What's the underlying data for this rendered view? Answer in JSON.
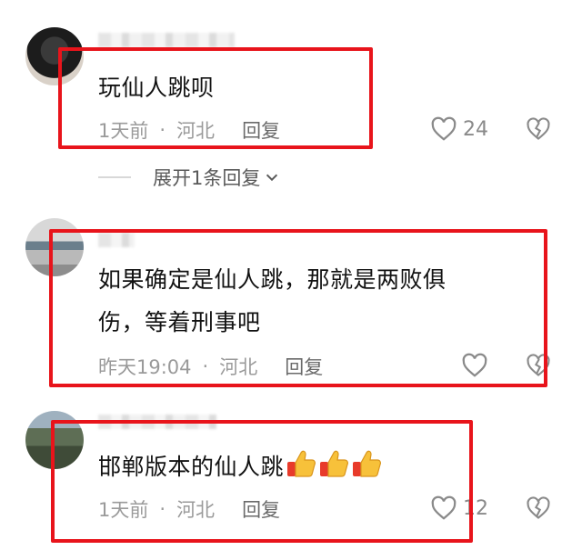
{
  "comments": [
    {
      "text": "玩仙人跳呗",
      "time": "1天前",
      "sep": "·",
      "location": "河北",
      "reply_label": "回复",
      "like_count": "24"
    },
    {
      "text_line1": "如果确定是仙人跳，那就是两败俱",
      "text_line2": "伤，等着刑事吧",
      "time": "昨天19:04",
      "sep": "·",
      "location": "河北",
      "reply_label": "回复",
      "like_count": ""
    },
    {
      "text": "邯郸版本的仙人跳",
      "emojis": [
        "thumbs-up",
        "thumbs-up",
        "thumbs-up"
      ],
      "time": "1天前",
      "sep": "·",
      "location": "河北",
      "reply_label": "回复",
      "like_count": "12"
    }
  ],
  "expand_replies": {
    "label": "展开1条回复",
    "icon": "chevron-down-icon"
  },
  "colors": {
    "highlight_box": "#e8141b",
    "meta_text": "#9a9a9a",
    "body_text": "#121212"
  }
}
